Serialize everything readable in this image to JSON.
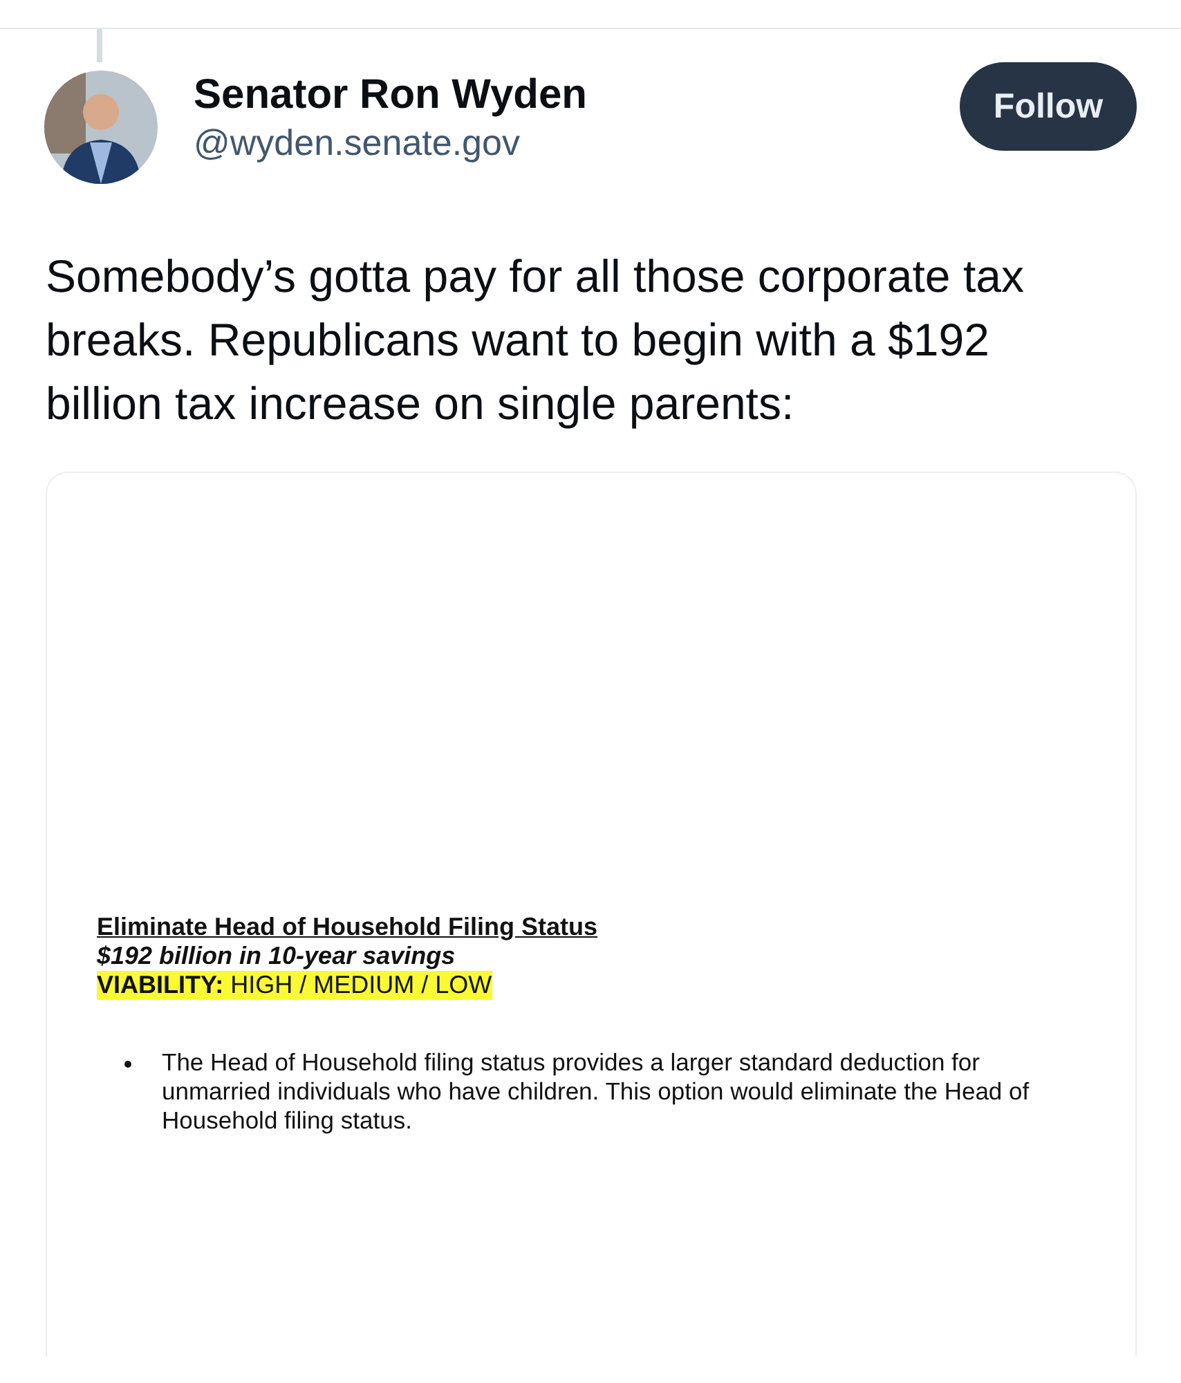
{
  "post": {
    "author": {
      "name": "Senator Ron Wyden",
      "handle": "@wyden.senate.gov"
    },
    "follow_button": "Follow",
    "text": "Somebody’s gotta pay for all those corporate tax breaks. Republicans want to begin with a $192 billion tax increase on single parents:",
    "attachment": {
      "kind": "document",
      "heading": "Eliminate Head of Household Filing Status",
      "subheading": "$192 billion in 10-year savings",
      "viability_label": "VIABILITY:",
      "viability_value": "HIGH / MEDIUM / LOW",
      "bullets": [
        "The Head of Household filing status provides a larger standard deduction for unmarried individuals who have children. This option would eliminate the Head of Household filing status."
      ]
    }
  }
}
